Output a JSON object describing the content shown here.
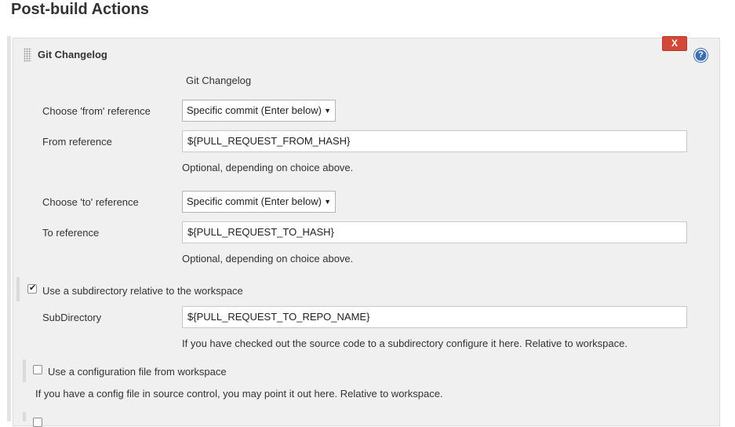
{
  "page": {
    "heading": "Post-build Actions"
  },
  "publisher": {
    "title": "Git Changelog",
    "delete_label": "X",
    "help_label": "?",
    "display_name": "Git Changelog",
    "from_choice": {
      "label": "Choose 'from' reference",
      "selected": "Specific commit (Enter below)"
    },
    "from_reference": {
      "label": "From reference",
      "value": "${PULL_REQUEST_FROM_HASH}",
      "help": "Optional, depending on choice above."
    },
    "to_choice": {
      "label": "Choose 'to' reference",
      "selected": "Specific commit (Enter below)"
    },
    "to_reference": {
      "label": "To reference",
      "value": "${PULL_REQUEST_TO_HASH}",
      "help": "Optional, depending on choice above."
    },
    "subdirectory_option": {
      "label": "Use a subdirectory relative to the workspace",
      "checked": true
    },
    "subdirectory": {
      "label": "SubDirectory",
      "value": "${PULL_REQUEST_TO_REPO_NAME}",
      "help": "If you have checked out the source code to a subdirectory configure it here. Relative to workspace."
    },
    "config_file_option": {
      "label": "Use a configuration file from workspace",
      "checked": false,
      "help": "If you have a config file in source control, you may point it out here. Relative to workspace."
    },
    "next_option": {
      "checked": false
    }
  },
  "icons": {
    "drag": "drag-handle-icon",
    "help": "help-icon",
    "dropdown": "chevron-down-icon"
  }
}
